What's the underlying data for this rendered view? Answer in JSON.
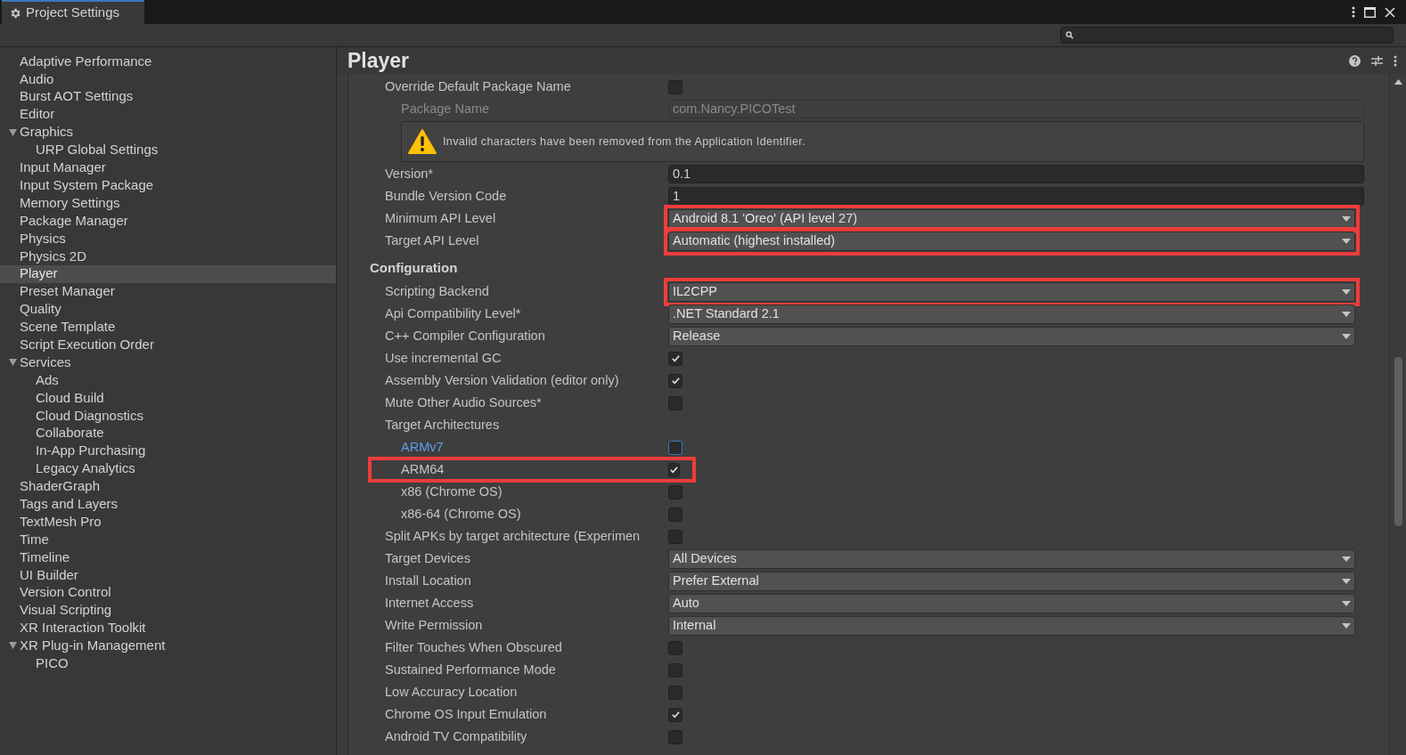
{
  "window": {
    "tab_title": "Project Settings"
  },
  "sidebar": {
    "items": [
      {
        "label": "Adaptive Performance",
        "selected": false
      },
      {
        "label": "Audio",
        "selected": false
      },
      {
        "label": "Burst AOT Settings",
        "selected": false
      },
      {
        "label": "Editor",
        "selected": false
      },
      {
        "label": "Graphics",
        "selected": false,
        "expanded": true,
        "children": [
          {
            "label": "URP Global Settings",
            "selected": false
          }
        ]
      },
      {
        "label": "Input Manager",
        "selected": false
      },
      {
        "label": "Input System Package",
        "selected": false
      },
      {
        "label": "Memory Settings",
        "selected": false
      },
      {
        "label": "Package Manager",
        "selected": false
      },
      {
        "label": "Physics",
        "selected": false
      },
      {
        "label": "Physics 2D",
        "selected": false
      },
      {
        "label": "Player",
        "selected": true
      },
      {
        "label": "Preset Manager",
        "selected": false
      },
      {
        "label": "Quality",
        "selected": false
      },
      {
        "label": "Scene Template",
        "selected": false
      },
      {
        "label": "Script Execution Order",
        "selected": false
      },
      {
        "label": "Services",
        "selected": false,
        "expanded": true,
        "children": [
          {
            "label": "Ads",
            "selected": false
          },
          {
            "label": "Cloud Build",
            "selected": false
          },
          {
            "label": "Cloud Diagnostics",
            "selected": false
          },
          {
            "label": "Collaborate",
            "selected": false
          },
          {
            "label": "In-App Purchasing",
            "selected": false
          },
          {
            "label": "Legacy Analytics",
            "selected": false
          }
        ]
      },
      {
        "label": "ShaderGraph",
        "selected": false
      },
      {
        "label": "Tags and Layers",
        "selected": false
      },
      {
        "label": "TextMesh Pro",
        "selected": false
      },
      {
        "label": "Time",
        "selected": false
      },
      {
        "label": "Timeline",
        "selected": false
      },
      {
        "label": "UI Builder",
        "selected": false
      },
      {
        "label": "Version Control",
        "selected": false
      },
      {
        "label": "Visual Scripting",
        "selected": false
      },
      {
        "label": "XR Interaction Toolkit",
        "selected": false
      },
      {
        "label": "XR Plug-in Management",
        "selected": false,
        "expanded": true,
        "children": [
          {
            "label": "PICO",
            "selected": false
          }
        ]
      }
    ]
  },
  "panel": {
    "title": "Player",
    "rows": [
      {
        "kind": "toggle",
        "label": "Override Default Package Name",
        "checked": false,
        "children": [
          {
            "kind": "field",
            "label": "Package Name",
            "value": "com.Nancy.PICOTest",
            "disabled": true
          },
          {
            "kind": "warning",
            "text": "Invalid characters have been removed from the Application Identifier."
          }
        ]
      },
      {
        "kind": "field",
        "label": "Version*",
        "value": "0.1",
        "disabled": false
      },
      {
        "kind": "field",
        "label": "Bundle Version Code",
        "value": "1",
        "disabled": false
      },
      {
        "kind": "dropdown",
        "label": "Minimum API Level",
        "value": "Android 8.1 'Oreo' (API level 27)",
        "highlighted": true
      },
      {
        "kind": "dropdown",
        "label": "Target API Level",
        "value": "Automatic (highest installed)",
        "highlighted": true
      },
      {
        "kind": "header",
        "label": "Configuration"
      },
      {
        "kind": "dropdown",
        "label": "Scripting Backend",
        "value": "IL2CPP",
        "highlighted": true
      },
      {
        "kind": "dropdown",
        "label": "Api Compatibility Level*",
        "value": ".NET Standard 2.1",
        "highlighted": false
      },
      {
        "kind": "dropdown",
        "label": "C++ Compiler Configuration",
        "value": "Release",
        "highlighted": false
      },
      {
        "kind": "toggle",
        "label": "Use incremental GC",
        "checked": true
      },
      {
        "kind": "toggle",
        "label": "Assembly Version Validation (editor only)",
        "checked": true
      },
      {
        "kind": "toggle",
        "label": "Mute Other Audio Sources*",
        "checked": false
      },
      {
        "kind": "group",
        "label": "Target Architectures",
        "children": [
          {
            "kind": "toggle",
            "label": "ARMv7",
            "checked": false,
            "focused": true,
            "highlighted": false
          },
          {
            "kind": "toggle",
            "label": "ARM64",
            "checked": true,
            "focused": false,
            "highlighted": true
          },
          {
            "kind": "toggle",
            "label": "x86 (Chrome OS)",
            "checked": false,
            "focused": false,
            "highlighted": false
          },
          {
            "kind": "toggle",
            "label": "x86-64 (Chrome OS)",
            "checked": false,
            "focused": false,
            "highlighted": false
          }
        ]
      },
      {
        "kind": "toggle",
        "label": "Split APKs by target architecture (Experimen",
        "checked": false
      },
      {
        "kind": "dropdown",
        "label": "Target Devices",
        "value": "All Devices",
        "highlighted": false
      },
      {
        "kind": "dropdown",
        "label": "Install Location",
        "value": "Prefer External",
        "highlighted": false
      },
      {
        "kind": "dropdown",
        "label": "Internet Access",
        "value": "Auto",
        "highlighted": false
      },
      {
        "kind": "dropdown",
        "label": "Write Permission",
        "value": "Internal",
        "highlighted": false
      },
      {
        "kind": "toggle",
        "label": "Filter Touches When Obscured",
        "checked": false
      },
      {
        "kind": "toggle",
        "label": "Sustained Performance Mode",
        "checked": false
      },
      {
        "kind": "toggle",
        "label": "Low Accuracy Location",
        "checked": false
      },
      {
        "kind": "toggle",
        "label": "Chrome OS Input Emulation",
        "checked": true
      },
      {
        "kind": "toggle",
        "label": "Android TV Compatibility",
        "checked": false
      }
    ]
  }
}
